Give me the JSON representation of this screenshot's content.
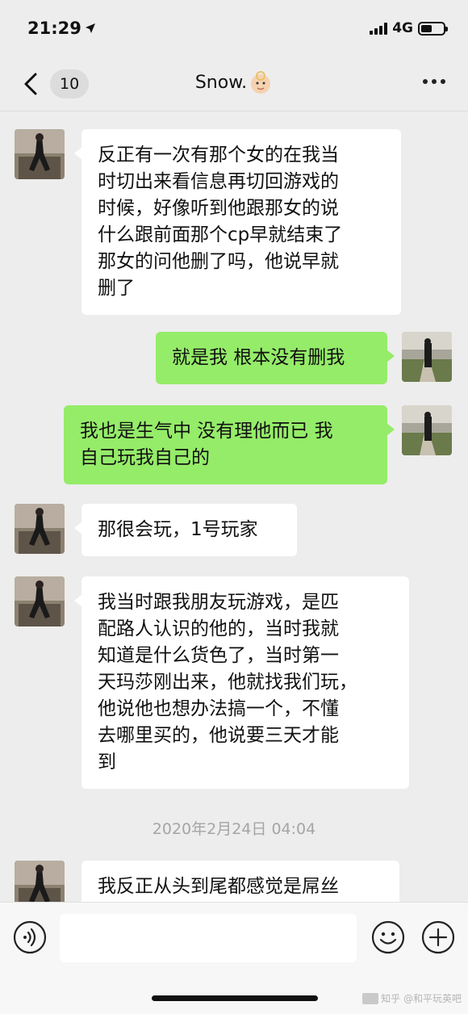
{
  "status_bar": {
    "time": "21:29",
    "network": "4G",
    "battery_level": 0.5
  },
  "nav": {
    "unread_count": "10",
    "title": "Snow."
  },
  "messages": [
    {
      "side": "left",
      "text": "反正有一次有那个女的在我当\n时切出来看信息再切回游戏的\n时候，好像听到他跟那女的说\n什么跟前面那个cp早就结束了\n那女的问他删了吗，他说早就\n删了"
    },
    {
      "side": "right",
      "text": "就是我 根本没有删我"
    },
    {
      "side": "right",
      "text": "我也是生气中 没有理他而已 我\n自己玩我自己的"
    },
    {
      "side": "left",
      "text": "那很会玩，1号玩家"
    },
    {
      "side": "left",
      "text": "我当时跟我朋友玩游戏，是匹\n配路人认识的他的，当时我就\n知道是什么货色了，当时第一\n天玛莎刚出来，他就找我们玩，\n他说他也想办法搞一个，不懂\n去哪里买的，他说要三天才能\n到"
    },
    {
      "side": "left",
      "text": "我反正从头到尾都感觉是屌丝"
    }
  ],
  "timestamp": "2020年2月24日 04:04",
  "input": {
    "placeholder": ""
  },
  "watermark": "知乎 @和平玩英吧",
  "colors": {
    "background": "#ededed",
    "incoming_bubble": "#ffffff",
    "outgoing_bubble": "#95ec69",
    "timestamp": "#a5a5a5"
  },
  "icons": [
    "back-chevron-icon",
    "baby-emoji-icon",
    "more-icon",
    "voice-icon",
    "emoji-icon",
    "plus-icon"
  ]
}
